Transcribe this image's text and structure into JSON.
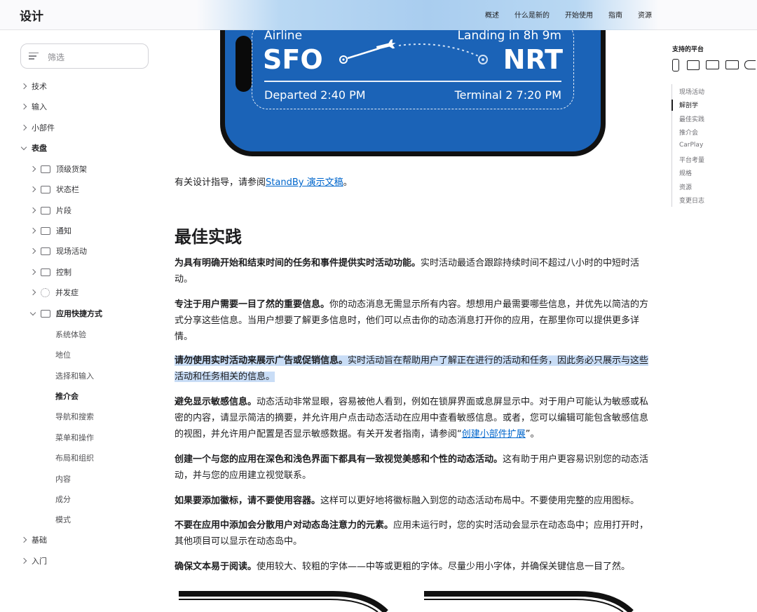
{
  "header": {
    "site_title": "设计",
    "nav": [
      "概述",
      "什么是新的",
      "开始使用",
      "指南",
      "资源"
    ]
  },
  "sidebar": {
    "filter_placeholder": "筛选",
    "top_items": [
      "技术",
      "输入",
      "小部件",
      "表盘"
    ],
    "sub_items": [
      "顶级货架",
      "状态栏",
      "片段",
      "通知",
      "现场活动",
      "控制",
      "并发症",
      "应用快捷方式"
    ],
    "leaf_items": [
      "系统体验",
      "地位",
      "选择和输入",
      "推介会",
      "导航和搜索",
      "菜单和操作",
      "布局和组织",
      "内容",
      "成分",
      "模式"
    ],
    "bottom_items": [
      "基础",
      "入门"
    ],
    "active_leaf": "推介会"
  },
  "flight": {
    "airline": "Airline",
    "landing": "Landing in 8h 9m",
    "from": "SFO",
    "to": "NRT",
    "departed": "Departed 2:40 PM",
    "terminal": "Terminal 2 7:20 PM"
  },
  "article": {
    "intro_prefix": "有关设计指导，请参阅",
    "intro_link": "StandBy 演示文稿",
    "intro_suffix": "。",
    "heading": "最佳实践",
    "p1_bold": "为具有明确开始和结束时间的任务和事件提供实时活动功能。",
    "p1_text": "实时活动最适合跟踪持续时间不超过八小时的中短时活动。",
    "p2_bold": "专注于用户需要一目了然的重要信息。",
    "p2_text": "你的动态消息无需显示所有内容。想想用户最需要哪些信息，并优先以简洁的方式分享这些信息。当用户想要了解更多信息时，他们可以点击你的动态消息打开你的应用，在那里你可以提供更多详情。",
    "p3_bold": "请勿使用实时活动来展示广告或促销信息。",
    "p3_text": "实时活动旨在帮助用户了解正在进行的活动和任务，因此务必只展示与这些活动和任务相关的信息。",
    "p4_bold": "避免显示敏感信息。",
    "p4_text": "动态活动非常显眼，容易被他人看到，例如在锁屏界面或息屏显示中。对于用户可能认为敏感或私密的内容，请显示简洁的摘要，并允许用户点击动态活动在应用中查看敏感信息。或者，您可以编辑可能包含敏感信息的视图，并允许用户配置是否显示敏感数据。有关开发者指南，请参阅“",
    "p4_link": "创建小部件扩展",
    "p4_suffix": "”。",
    "p5_bold": "创建一个与您的应用在深色和浅色界面下都具有一致视觉美感和个性的动态活动。",
    "p5_text": "这有助于用户更容易识别您的动态活动，并与您的应用建立视觉联系。",
    "p6_bold": "如果要添加徽标，请不要使用容器。",
    "p6_text": "这样可以更好地将徽标融入到您的动态活动布局中。不要使用完整的应用图标。",
    "p7_bold": "不要在应用中添加会分散用户对动态岛注意力的元素。",
    "p7_text": "应用未运行时，您的实时活动会显示在动态岛中；应用打开时，其他项目可以显示在动态岛中。",
    "p8_bold": "确保文本易于阅读。",
    "p8_text": "使用较大、较粗的字体——中等或更粗的字体。尽量少用小字体，并确保关键信息一目了然。"
  },
  "aside": {
    "platforms_title": "支持的平台",
    "platform_icons": [
      "iphone-icon",
      "ipad-icon",
      "mac-icon",
      "tv-icon",
      "carplay-icon"
    ],
    "toc": [
      "现场活动",
      "解剖学",
      "最佳实践",
      "推介会",
      "CarPlay",
      "平台考量",
      "规格",
      "资源",
      "变更日志"
    ],
    "toc_active": "解剖学"
  },
  "colors": {
    "accent_link": "#0066cc",
    "card_blue": "#1b63b7",
    "highlight": "#c9ddf6"
  }
}
